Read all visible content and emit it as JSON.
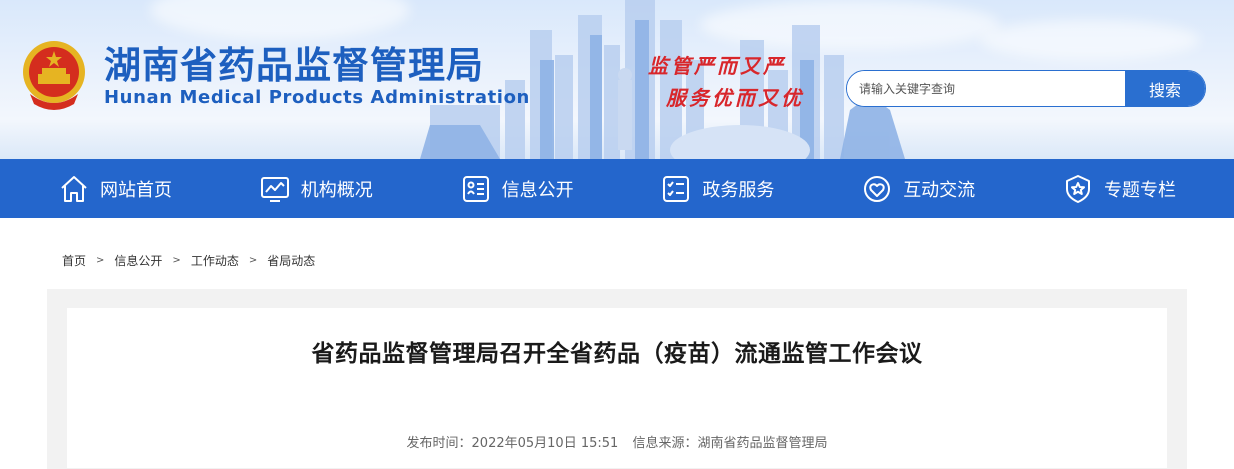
{
  "header": {
    "site_title": "湖南省药品监督管理局",
    "site_subtitle": "Hunan Medical Products Administration",
    "slogan_line1": "监管严而又严",
    "slogan_line2": "服务优而又优",
    "search": {
      "placeholder": "请输入关键字查询",
      "button_label": "搜索"
    }
  },
  "nav": {
    "items": [
      {
        "label": "网站首页",
        "icon": "home-icon"
      },
      {
        "label": "机构概况",
        "icon": "chart-screen-icon"
      },
      {
        "label": "信息公开",
        "icon": "info-card-icon"
      },
      {
        "label": "政务服务",
        "icon": "checklist-icon"
      },
      {
        "label": "互动交流",
        "icon": "heart-chat-icon"
      },
      {
        "label": "专题专栏",
        "icon": "star-shield-icon"
      }
    ]
  },
  "breadcrumb": [
    "首页",
    "信息公开",
    "工作动态",
    "省局动态"
  ],
  "article": {
    "title": "省药品监督管理局召开全省药品（疫苗）流通监管工作会议",
    "publish_time": "发布时间：2022年05月10日 15:51",
    "source": "信息来源：湖南省药品监督管理局"
  },
  "colors": {
    "brand_blue": "#2466cc",
    "title_blue": "#1d5fbf",
    "slogan_red": "#d8262b"
  }
}
